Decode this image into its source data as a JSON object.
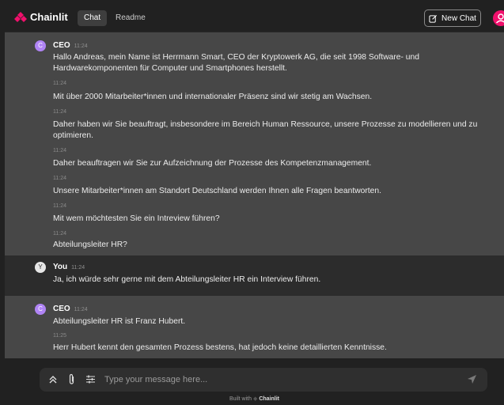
{
  "app": {
    "name": "Chainlit",
    "brand_color": "#f0106c",
    "ceo_avatar_color": "#b084f5"
  },
  "header": {
    "tabs": [
      {
        "label": "Chat",
        "active": true
      },
      {
        "label": "Readme",
        "active": false
      }
    ],
    "new_chat_label": "New Chat",
    "icons": [
      "chainlit-logo-icon",
      "new-chat-icon",
      "user-avatar-icon"
    ]
  },
  "messages": [
    {
      "author": "CEO",
      "avatar": "C",
      "time": "11:24",
      "items": [
        {
          "text": "Hallo Andreas, mein Name ist Herrmann Smart, CEO der Kryptowerk AG, die seit 1998 Software- und Hardwarekomponenten für Computer und Smartphones herstellt.",
          "time": "11:24"
        },
        {
          "text": "Mit über 2000 Mitarbeiter*innen und internationaler Präsenz sind wir stetig am Wachsen.",
          "time": "11:24"
        },
        {
          "text": "Daher haben wir Sie beauftragt, insbesondere im Bereich Human Ressource, unsere Prozesse zu modellieren und zu optimieren.",
          "time": "11:24"
        },
        {
          "text": "Daher beauftragen wir Sie zur Aufzeichnung der Prozesse des Kompetenzmanagement.",
          "time": "11:24"
        },
        {
          "text": "Unsere Mitarbeiter*innen am Standort Deutschland werden Ihnen alle Fragen beantworten.",
          "time": "11:24"
        },
        {
          "text": "Mit wem möchtesten Sie ein Intreview führen?",
          "time": "11:24"
        },
        {
          "text": "Abteilungsleiter HR?",
          "time": ""
        }
      ]
    },
    {
      "author": "You",
      "avatar": "Y",
      "time": "11:24",
      "items": [
        {
          "text": "Ja, ich würde sehr gerne mit dem Abteilungsleiter HR ein Interview führen.",
          "time": ""
        }
      ]
    },
    {
      "author": "CEO",
      "avatar": "C",
      "time": "11:24",
      "items": [
        {
          "text": "Abteilungsleiter HR ist Franz Hubert.",
          "time": "11:25"
        },
        {
          "text": "Herr Hubert kennt den gesamten Prozess bestens, hat jedoch keine detaillierten Kenntnisse.",
          "time": ""
        }
      ]
    }
  ],
  "composer": {
    "placeholder": "Type your message here...",
    "icons": [
      "chevrons-up-icon",
      "paperclip-icon",
      "settings-sliders-icon",
      "send-icon"
    ]
  },
  "footer": {
    "prefix": "Built with",
    "brand": "Chainlit"
  }
}
